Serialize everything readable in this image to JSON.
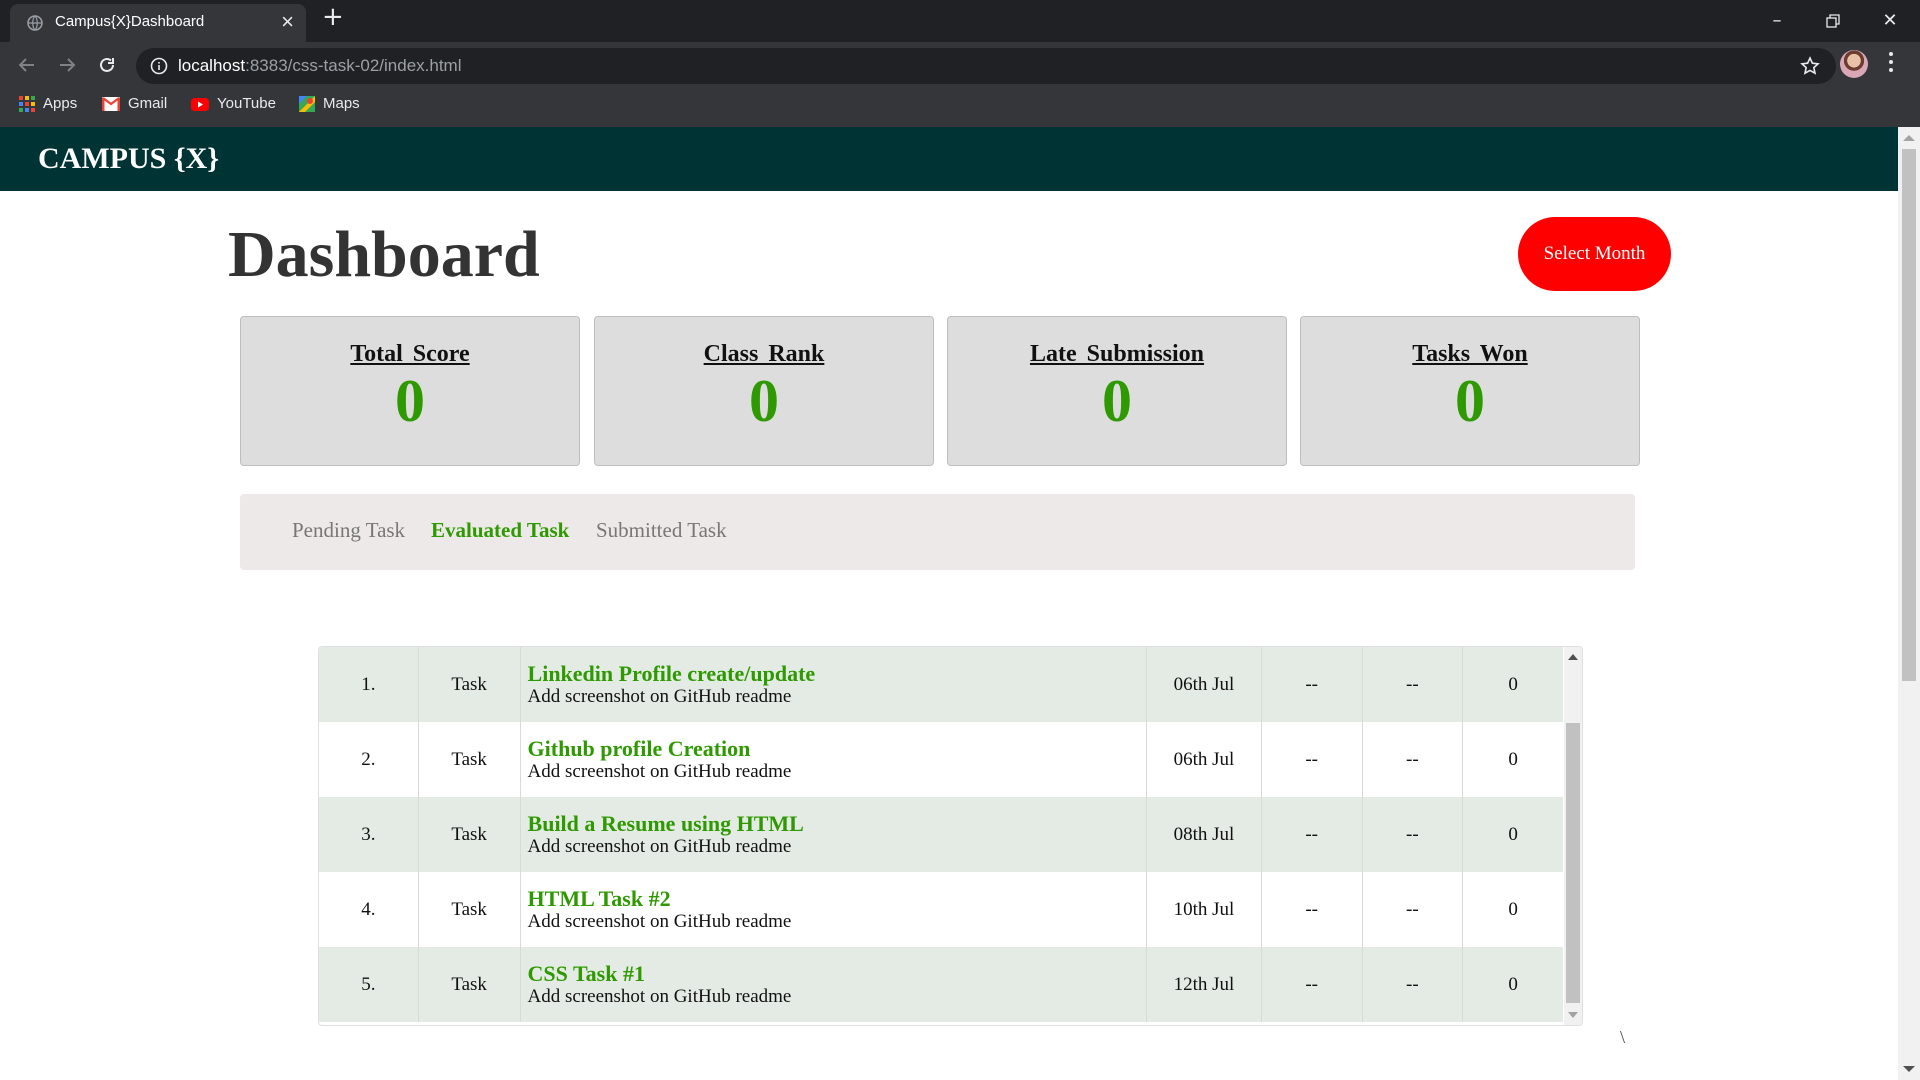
{
  "browser": {
    "tab_title": "Campus{X}Dashboard",
    "new_tab_symbol": "+",
    "url_host": "localhost",
    "url_rest": ":8383/css-task-02/index.html",
    "bookmarks": [
      {
        "label": "Apps",
        "icon": "apps-grid-icon"
      },
      {
        "label": "Gmail",
        "icon": "gmail-icon"
      },
      {
        "label": "YouTube",
        "icon": "youtube-icon"
      },
      {
        "label": "Maps",
        "icon": "maps-icon"
      }
    ]
  },
  "navbar": {
    "brand": "CAMPUS {X}"
  },
  "header": {
    "title": "Dashboard",
    "select_month_label": "Select Month"
  },
  "stats": [
    {
      "label": "Total Score",
      "value": "0"
    },
    {
      "label": "Class Rank",
      "value": "0"
    },
    {
      "label": "Late Submission",
      "value": "0"
    },
    {
      "label": "Tasks Won",
      "value": "0"
    }
  ],
  "task_tabs": [
    {
      "label": "Pending Task",
      "active": false
    },
    {
      "label": "Evaluated Task",
      "active": true
    },
    {
      "label": "Submitted Task",
      "active": false
    }
  ],
  "tasks": [
    {
      "num": "1.",
      "type": "Task",
      "title": "Linkedin Profile create/update",
      "subtitle": "Add screenshot on GitHub readme",
      "date": "06th Jul",
      "col_a": "--",
      "col_b": "--",
      "score": "0"
    },
    {
      "num": "2.",
      "type": "Task",
      "title": "Github profile Creation",
      "subtitle": "Add screenshot on GitHub readme",
      "date": "06th Jul",
      "col_a": "--",
      "col_b": "--",
      "score": "0"
    },
    {
      "num": "3.",
      "type": "Task",
      "title": "Build a Resume using HTML",
      "subtitle": "Add screenshot on GitHub readme",
      "date": "08th Jul",
      "col_a": "--",
      "col_b": "--",
      "score": "0"
    },
    {
      "num": "4.",
      "type": "Task",
      "title": "HTML Task #2",
      "subtitle": "Add screenshot on GitHub readme",
      "date": "10th Jul",
      "col_a": "--",
      "col_b": "--",
      "score": "0"
    },
    {
      "num": "5.",
      "type": "Task",
      "title": "CSS Task #1",
      "subtitle": "Add screenshot on GitHub readme",
      "date": "12th Jul",
      "col_a": "--",
      "col_b": "--",
      "score": "0"
    }
  ],
  "stray_text": "\\",
  "colors": {
    "navbar": "#003333",
    "accent_green": "#2e9900",
    "select_month": "#ff0000",
    "card_bg": "#dddddd",
    "tabs_bg": "#ede9e8",
    "row_alt": "#e4ebe4"
  }
}
